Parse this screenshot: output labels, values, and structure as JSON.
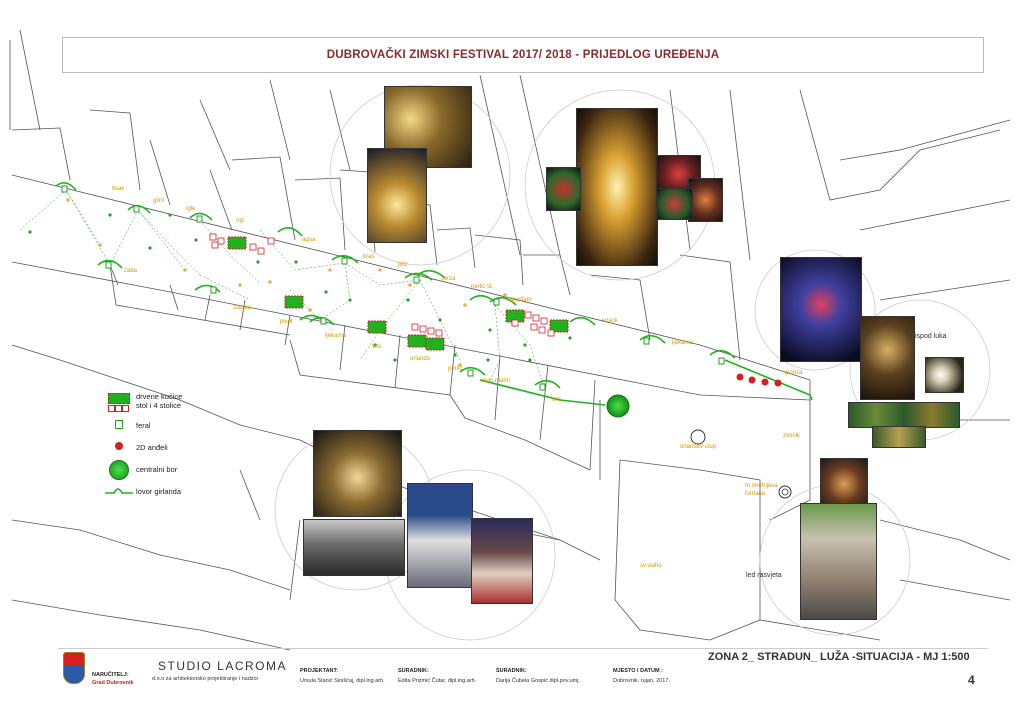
{
  "title": "DUBROVAČKI ZIMSKI FESTIVAL  2017/ 2018 - PRIJEDLOG UREĐENJA",
  "street_labels": {
    "tisak": "tisak",
    "glint": "glint",
    "igle": "igle",
    "otp": "otp",
    "aqua": "aqua",
    "kraš": "kraš",
    "pbz": "pbz",
    "terza": "terza",
    "perlic_st": "perlić st.",
    "algoritam": "algoritam",
    "snack": "snack",
    "ljekarna_right": "ljekarna",
    "sponza": "sponza",
    "zaba": "zaba",
    "zlatara": "zlatara",
    "pivot": "pivot",
    "ljekarna_mid": "ljekarna",
    "vilo": "vilo",
    "orlando": "orlando",
    "perlic": "perlić",
    "maraschino": "mas.marin",
    "oris": "oris",
    "orlandov_stup": "orlandov stup",
    "sv_vlaho": "sv.vlaho",
    "m_onofrijeva_fontana": "m.onofrijeva fontana",
    "zvonik": "zvonik",
    "ispod_luka": "ispod luka",
    "led_rasvjeta": "led rasvjeta"
  },
  "legend": {
    "items": [
      {
        "label": "drvene kućice",
        "icon": "wooden-house-icon"
      },
      {
        "label": "stol i 4 stolice",
        "icon": "table-chairs-icon"
      },
      {
        "label": "feral",
        "icon": "lantern-icon"
      },
      {
        "label": "2D anđeli",
        "icon": "angel-icon"
      },
      {
        "label": "centralni bor",
        "icon": "central-tree-icon"
      },
      {
        "label": "lovor girlanda",
        "icon": "laurel-garland-icon"
      }
    ]
  },
  "footer": {
    "narucitelj_label": "NARUČITELJ:",
    "narucitelj_value": "Grad Dubrovnik",
    "studio_name": "STUDIO LACROMA",
    "studio_sub": "d.o.o za arhitektonsko projektiranje i nadzor",
    "projektant_label": "PROJEKTANT:",
    "projektant_value": "Ursula Stanić Siniščaj, dipl.ing.arh.",
    "suradnik1_label": "SURADNIK:",
    "suradnik1_value": "Edita Prizmić Čutar, dipl.ing.arh.",
    "suradnik2_label": "SURADNIK:",
    "suradnik2_value": "Darija Čubela Gospić dipl.pov.umj.",
    "mjesto_label": "MJESTO I DATUM :",
    "mjesto_value": "Dubrovnik, rujan, 2017.",
    "zona": "ZONA 2_ STRADUN_ LUŽA -SITUACIJA - MJ 1:500",
    "page_number": "4"
  },
  "colors": {
    "title": "#8a2a2a",
    "label": "#d49a00",
    "green": "#1fb21f",
    "red": "#d42020"
  }
}
